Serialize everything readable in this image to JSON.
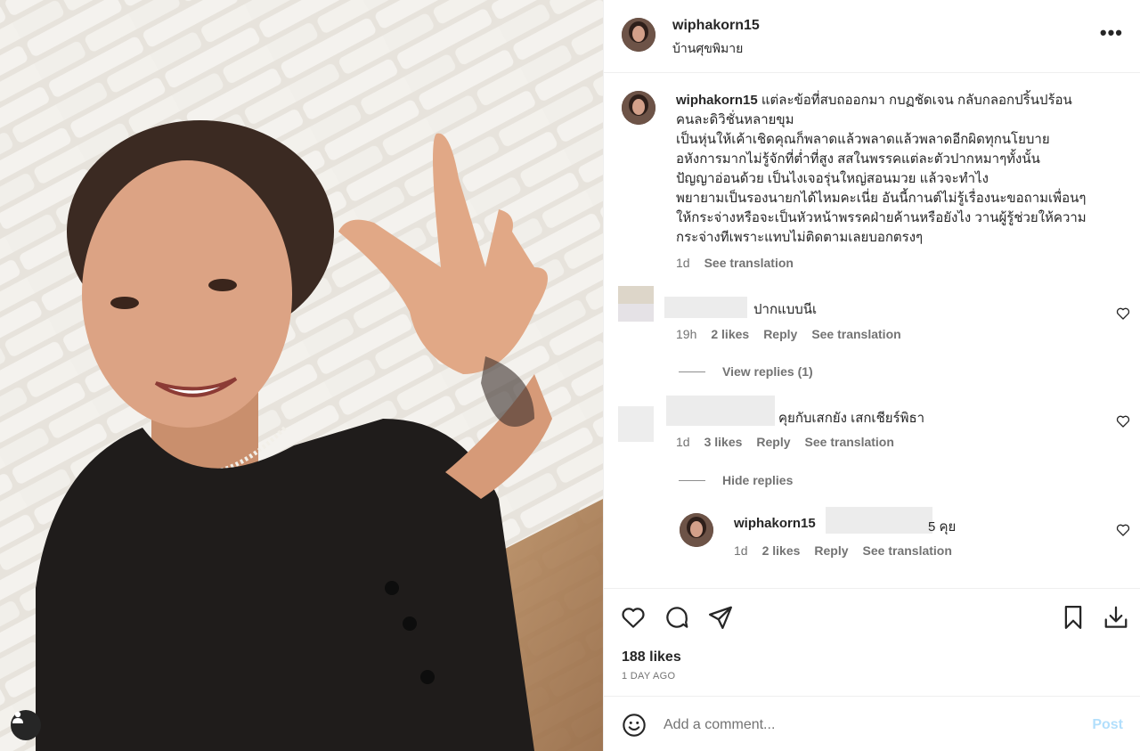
{
  "post": {
    "username": "wiphakorn15",
    "location": "บ้านศุขพิมาย",
    "caption_lines": [
      "แต่ละข้อที่สบถออกมา กบฏชัดเจน กลับกลอกปริ้นปร้อน",
      "คนละดิวิชั่นหลายขุม",
      "เป็นหุ่นให้เค้าเชิดคุณก็พลาดแล้วพลาดแล้วพลาดอีกผิดทุกนโยบาย",
      "อหังการมากไม่รู้จักที่ต่ำที่สูง สสในพรรคแต่ละตัวปากหมาๆทั้งนั้น",
      "ปัญญาอ่อนด้วย เป็นไงเจอรุ่นใหญ่สอนมวย แล้วจะทำไง",
      "พยายามเป็นรองนายกได้ไหมคะเนี่ย อันนี้กานต์ไม่รู้เรื่องนะขอถามเพื่อนๆ",
      "ให้กระจ่างหรือจะเป็นหัวหน้าพรรคฝ่ายค้านหรือยังไง วานผู้รู้ช่วยให้ความ",
      "กระจ่างทีเพราะแทบไม่ติดตามเลยบอกตรงๆ"
    ],
    "caption_time": "1d",
    "see_translation": "See translation",
    "likes": "188 likes",
    "time_ago": "1 DAY AGO"
  },
  "comments": [
    {
      "text": "ปากแบบนีเ",
      "time": "19h",
      "likes": "2 likes",
      "reply": "Reply",
      "translate": "See translation",
      "toggle": "View replies (1)"
    },
    {
      "text": "คุยกับเสกยัง เสกเชียร์พิธา",
      "time": "1d",
      "likes": "3 likes",
      "reply": "Reply",
      "translate": "See translation",
      "toggle": "Hide replies"
    }
  ],
  "reply": {
    "username": "wiphakorn15",
    "text": "5 คุย",
    "time": "1d",
    "likes": "2 likes",
    "reply": "Reply",
    "translate": "See translation"
  },
  "add_comment": {
    "placeholder": "Add a comment...",
    "post": "Post"
  },
  "icons": [
    "user-tag-icon",
    "more-icon",
    "heart-icon",
    "comment-icon",
    "share-icon",
    "bookmark-icon",
    "download-icon",
    "emoji-icon"
  ],
  "colors": {
    "text": "#262626",
    "muted": "#737373",
    "post_disabled": "#b2dffc",
    "border": "#efefef"
  }
}
